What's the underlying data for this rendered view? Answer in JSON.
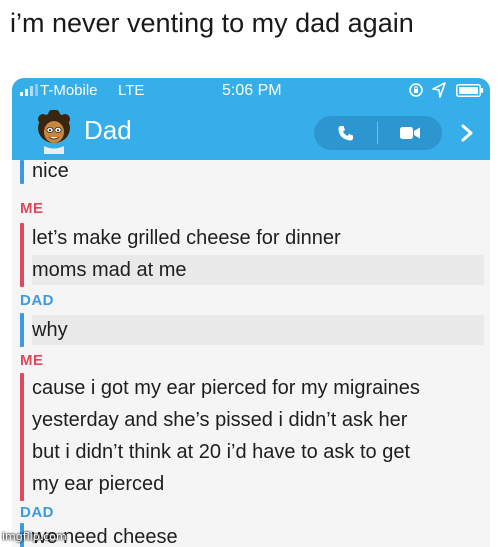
{
  "caption": "i’m never venting to my dad again",
  "status_bar": {
    "carrier": "T-Mobile",
    "network": "LTE",
    "time": "5:06 PM"
  },
  "header": {
    "contact_name": "Dad"
  },
  "chat": {
    "first_line": "nice",
    "me_label_1": "ME",
    "me_msg_1_line_1": "let’s make grilled cheese for dinner",
    "me_msg_1_line_2": "moms mad at me",
    "dad_label_1": "DAD",
    "dad_msg_1": "why",
    "me_label_2": "ME",
    "me_msg_2_line_1": "cause i got my ear pierced for my migraines",
    "me_msg_2_line_2": "yesterday and she’s pissed i didn’t ask her",
    "me_msg_2_line_3": "but i didn’t think at 20 i’d have to ask to get",
    "me_msg_2_line_4": "my ear pierced",
    "dad_label_2": "DAD",
    "dad_msg_2": "we need cheese"
  },
  "watermark": "imgflip.com",
  "colors": {
    "header": "#36aee9",
    "me": "#e1475e",
    "dad": "#3b9ae1"
  }
}
